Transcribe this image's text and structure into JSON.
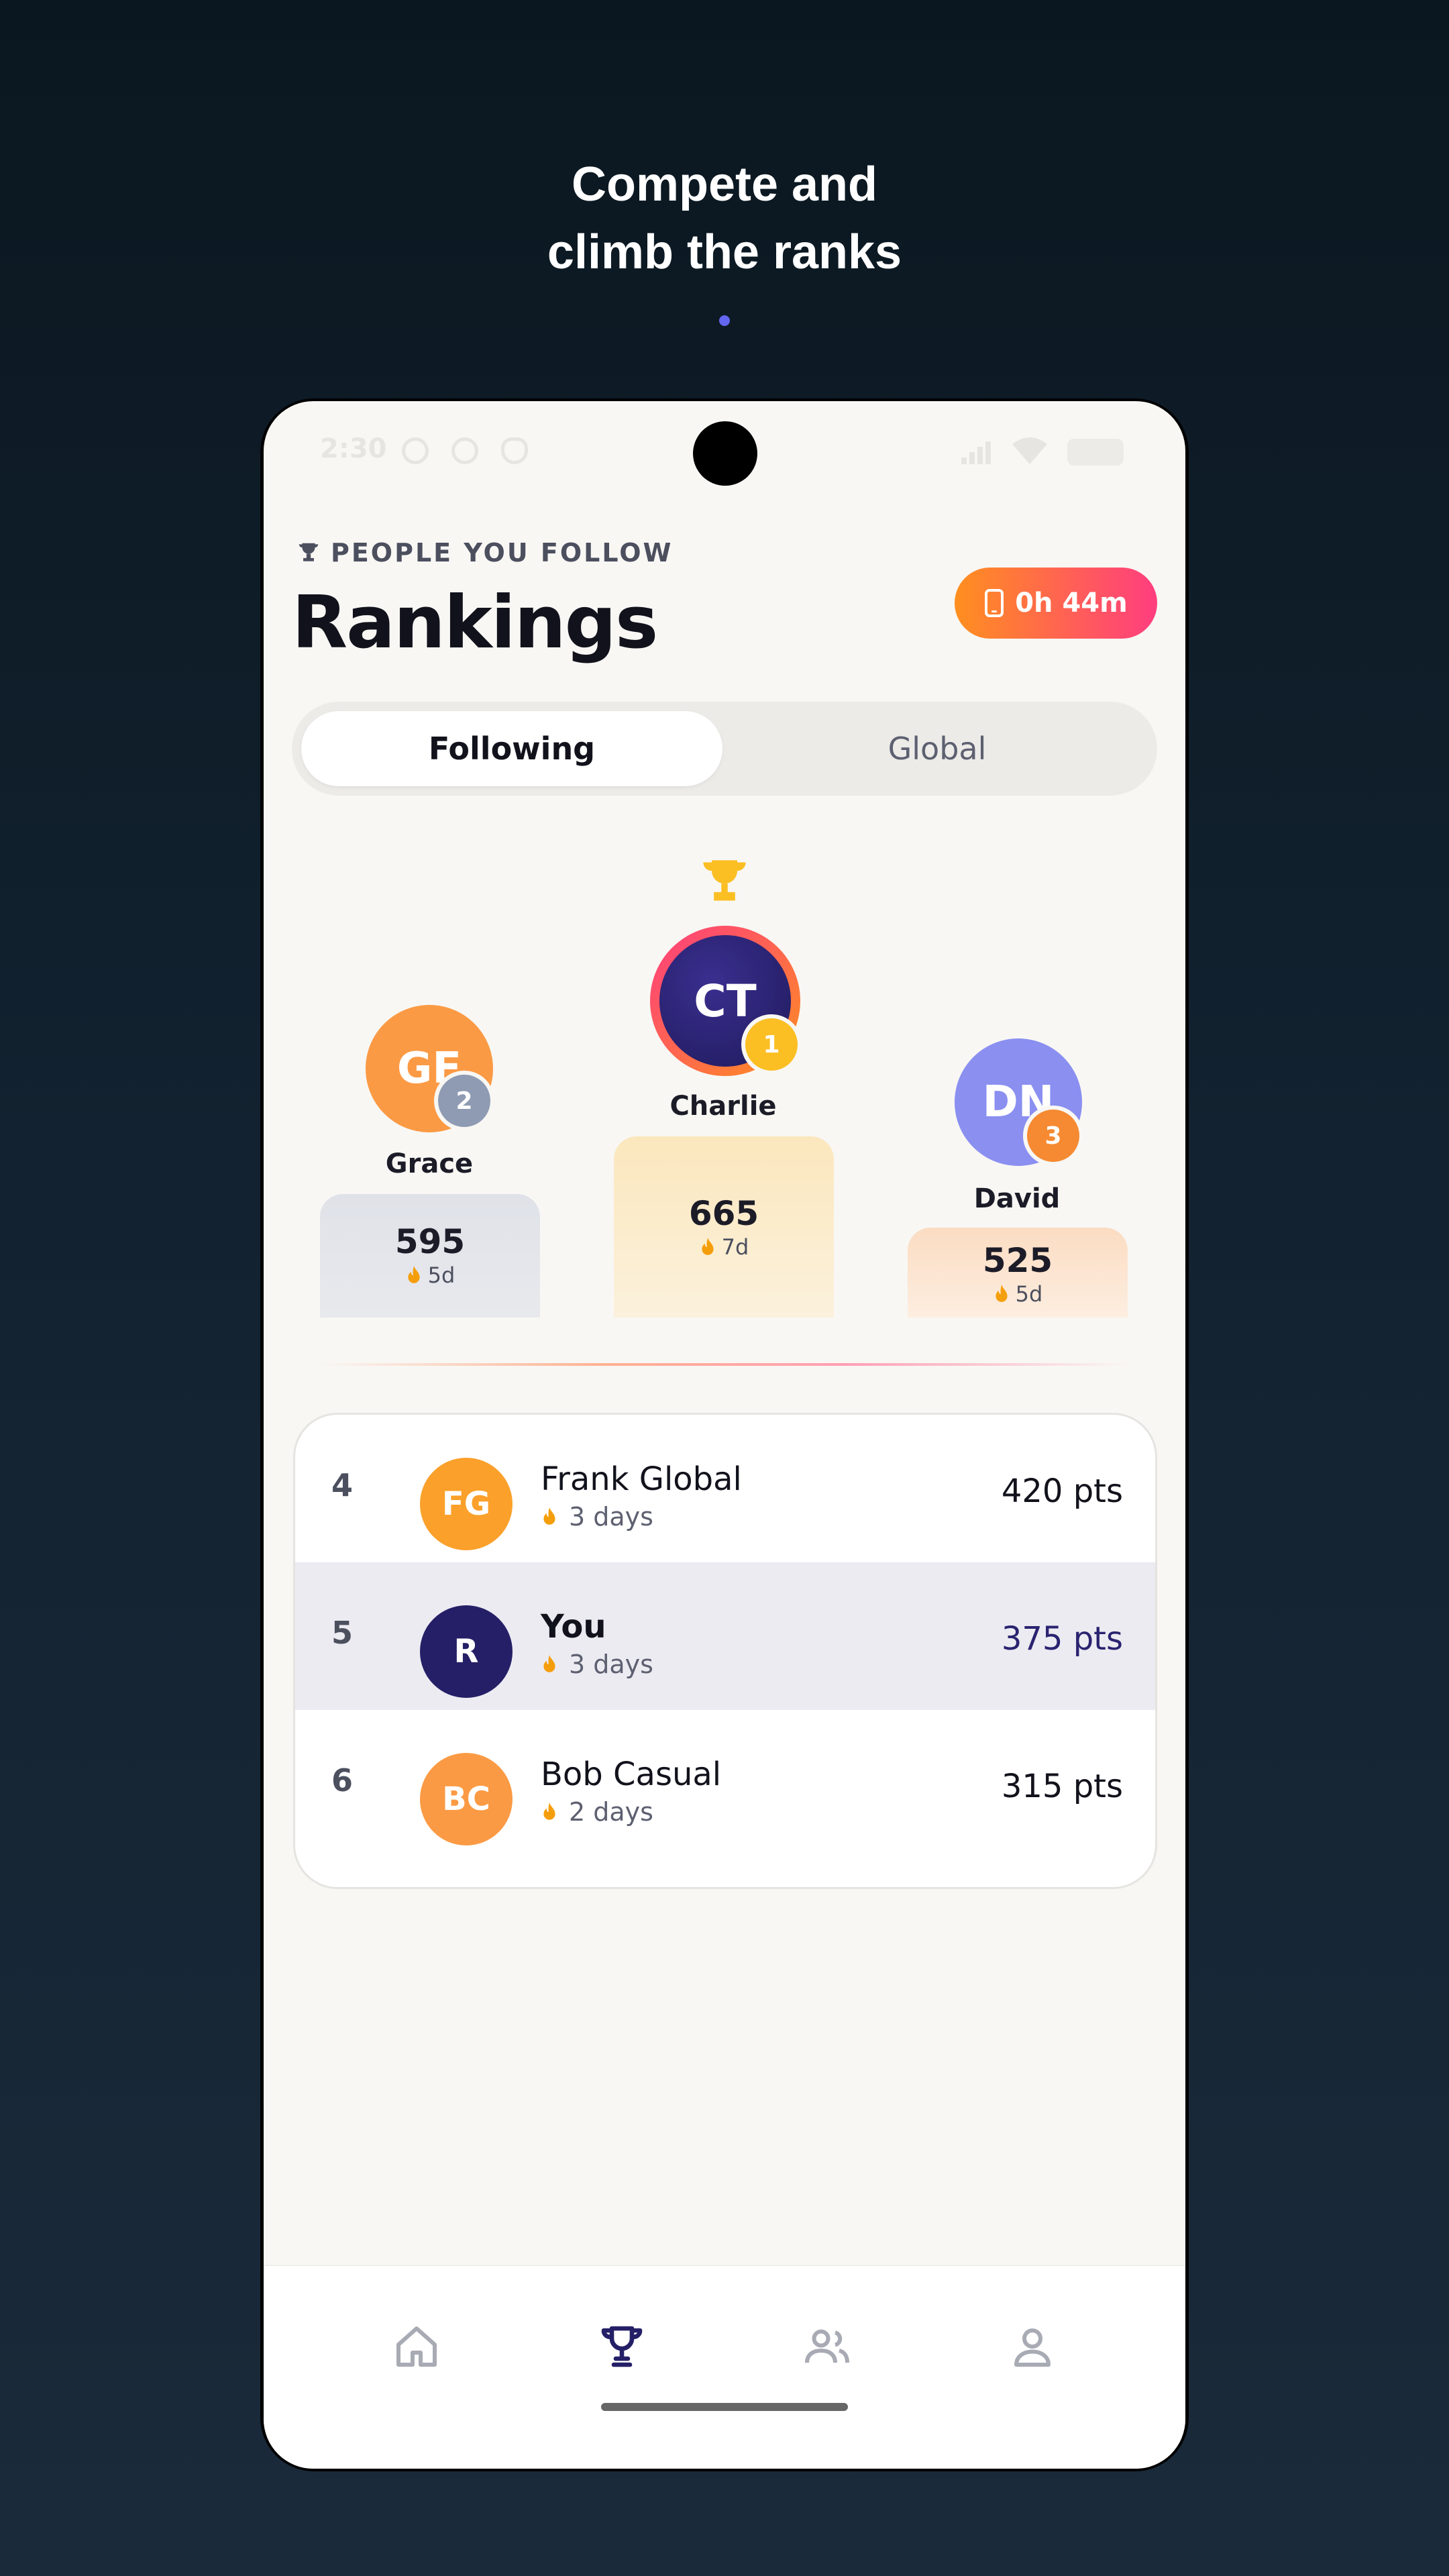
{
  "headline": {
    "line1": "Compete and",
    "line2": "climb the ranks"
  },
  "status_bar": {
    "time": "2:30"
  },
  "header": {
    "eyebrow": "PEOPLE YOU FOLLOW",
    "title": "Rankings",
    "timer": "0h 44m"
  },
  "tabs": {
    "active": "Following",
    "inactive": "Global"
  },
  "podium": [
    {
      "initials": "GF",
      "name": "Grace",
      "rank": "2",
      "score": "595",
      "streak": "5d"
    },
    {
      "initials": "CT",
      "name": "Charlie",
      "rank": "1",
      "score": "665",
      "streak": "7d"
    },
    {
      "initials": "DN",
      "name": "David",
      "rank": "3",
      "score": "525",
      "streak": "5d"
    }
  ],
  "list": [
    {
      "rank": "4",
      "initials": "FG",
      "name": "Frank Global",
      "streak": "3 days",
      "points": "420 pts",
      "avatar_color": "#fba02a"
    },
    {
      "rank": "5",
      "initials": "R",
      "name": "You",
      "streak": "3 days",
      "points": "375 pts",
      "avatar_color": "#241f66"
    },
    {
      "rank": "6",
      "initials": "BC",
      "name": "Bob Casual",
      "streak": "2 days",
      "points": "315 pts",
      "avatar_color": "#fb9a44"
    }
  ],
  "nav": [
    {
      "icon": "home-icon",
      "active": false
    },
    {
      "icon": "trophy-icon",
      "active": true
    },
    {
      "icon": "friends-icon",
      "active": false
    },
    {
      "icon": "profile-icon",
      "active": false
    }
  ],
  "colors": {
    "accent": "#241f66",
    "gold": "#fbbf24",
    "flame": "#f59e0b",
    "pill_start": "#ff8f1f",
    "pill_end": "#ff3d7f"
  }
}
